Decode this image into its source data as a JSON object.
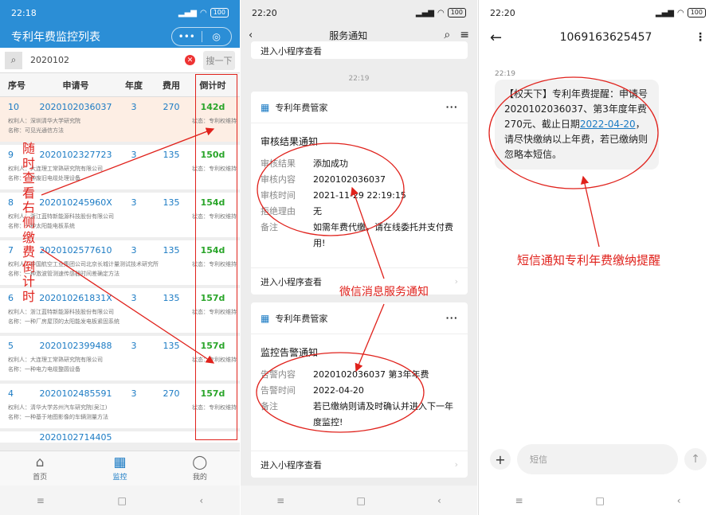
{
  "phone1": {
    "status_time": "22:18",
    "battery": "100",
    "title": "专利年费监控列表",
    "capsule_more": "•••",
    "capsule_close": "◎",
    "search_value": "2020102",
    "search_button": "搜一下",
    "columns": [
      "序号",
      "申请号",
      "年度",
      "费用",
      "倒计时"
    ],
    "rows": [
      {
        "no": "10",
        "app": "2020102036037",
        "year": "3",
        "fee": "270",
        "cd": "142d",
        "holder": "权利人：深圳清华大学研究院",
        "name": "名称：可见光通信方法",
        "status": "状态：专利权维持"
      },
      {
        "no": "9",
        "app": "2020102327723",
        "year": "3",
        "fee": "135",
        "cd": "150d",
        "holder": "权利人：大连理工常熟研究院有限公司",
        "name": "名称：一种废旧电缆处理设备",
        "status": "状态：专利权维持"
      },
      {
        "no": "8",
        "app": "202010245960X",
        "year": "3",
        "fee": "135",
        "cd": "154d",
        "holder": "权利人：浙江蓝特新能源科技股份有限公司",
        "name": "名称：一种太阳能电板系统",
        "status": "状态：专利权维持"
      },
      {
        "no": "7",
        "app": "2020102577610",
        "year": "3",
        "fee": "135",
        "cd": "154d",
        "holder": "权利人：中国航空工业集团公司北京长城计量测试技术研究所",
        "name": "名称：一种激波管测速传感器时间差确定方法",
        "status": "状态：专利权维持"
      },
      {
        "no": "6",
        "app": "202010261831X",
        "year": "3",
        "fee": "135",
        "cd": "157d",
        "holder": "权利人：浙江蓝特新能源科技股份有限公司",
        "name": "名称：一种厂房屋顶的太阳能发电板紧固系统",
        "status": "状态：专利权维持"
      },
      {
        "no": "5",
        "app": "2020102399488",
        "year": "3",
        "fee": "135",
        "cd": "157d",
        "holder": "权利人：大连理工常熟研究院有限公司",
        "name": "名称：一种电力电缆整圆设备",
        "status": "状态：专利权维持"
      },
      {
        "no": "4",
        "app": "2020102485591",
        "year": "3",
        "fee": "270",
        "cd": "157d",
        "holder": "权利人：清华大学苏州汽车研究院(吴江)",
        "name": "名称：一种基于地图影像的车辆测量方法",
        "status": "状态：专利权维持"
      }
    ],
    "partial_row": "2020102714405",
    "tabs": [
      {
        "label": "首页"
      },
      {
        "label": "监控"
      },
      {
        "label": "我的"
      }
    ],
    "annotation_vertical": "随时查看右侧缴费倒计时"
  },
  "phone2": {
    "status_time": "22:20",
    "battery": "100",
    "title": "服务通知",
    "top_link": "进入小程序查看",
    "time_label": "22:19",
    "card1": {
      "sender": "专利年费管家",
      "heading": "审核结果通知",
      "fields": [
        {
          "k": "审核结果",
          "v": "添加成功"
        },
        {
          "k": "审核内容",
          "v": "2020102036037"
        },
        {
          "k": "审核时间",
          "v": "2021-11-29 22:19:15"
        },
        {
          "k": "拒绝理由",
          "v": "无"
        },
        {
          "k": "备注",
          "v": "如需年费代缴，请在线委托并支付费用!"
        }
      ],
      "footer": "进入小程序查看"
    },
    "card2": {
      "sender": "专利年费管家",
      "heading": "监控告警通知",
      "fields": [
        {
          "k": "告警内容",
          "v": "2020102036037 第3年年费"
        },
        {
          "k": "告警时间",
          "v": "2022-04-20"
        },
        {
          "k": "备注",
          "v": "若已缴纳则请及时确认并进入下一年度监控!"
        }
      ],
      "footer": "进入小程序查看"
    },
    "annotation": "微信消息服务通知"
  },
  "phone3": {
    "status_time": "22:20",
    "battery": "100",
    "number": "1069163625457",
    "msg_time": "22:19",
    "msg_before": "【权天下】专利年费提醒：申请号2020102036037、第3年度年费270元、截止日期",
    "msg_link": "2022-04-20",
    "msg_after": "，请尽快缴纳以上年费，若已缴纳则忽略本短信。",
    "input_placeholder": "短信",
    "annotation": "短信通知专利年费缴纳提醒"
  },
  "colors": {
    "accent": "#2b8ed6",
    "annotation": "#e0221c",
    "countdown": "#2aa52a"
  }
}
